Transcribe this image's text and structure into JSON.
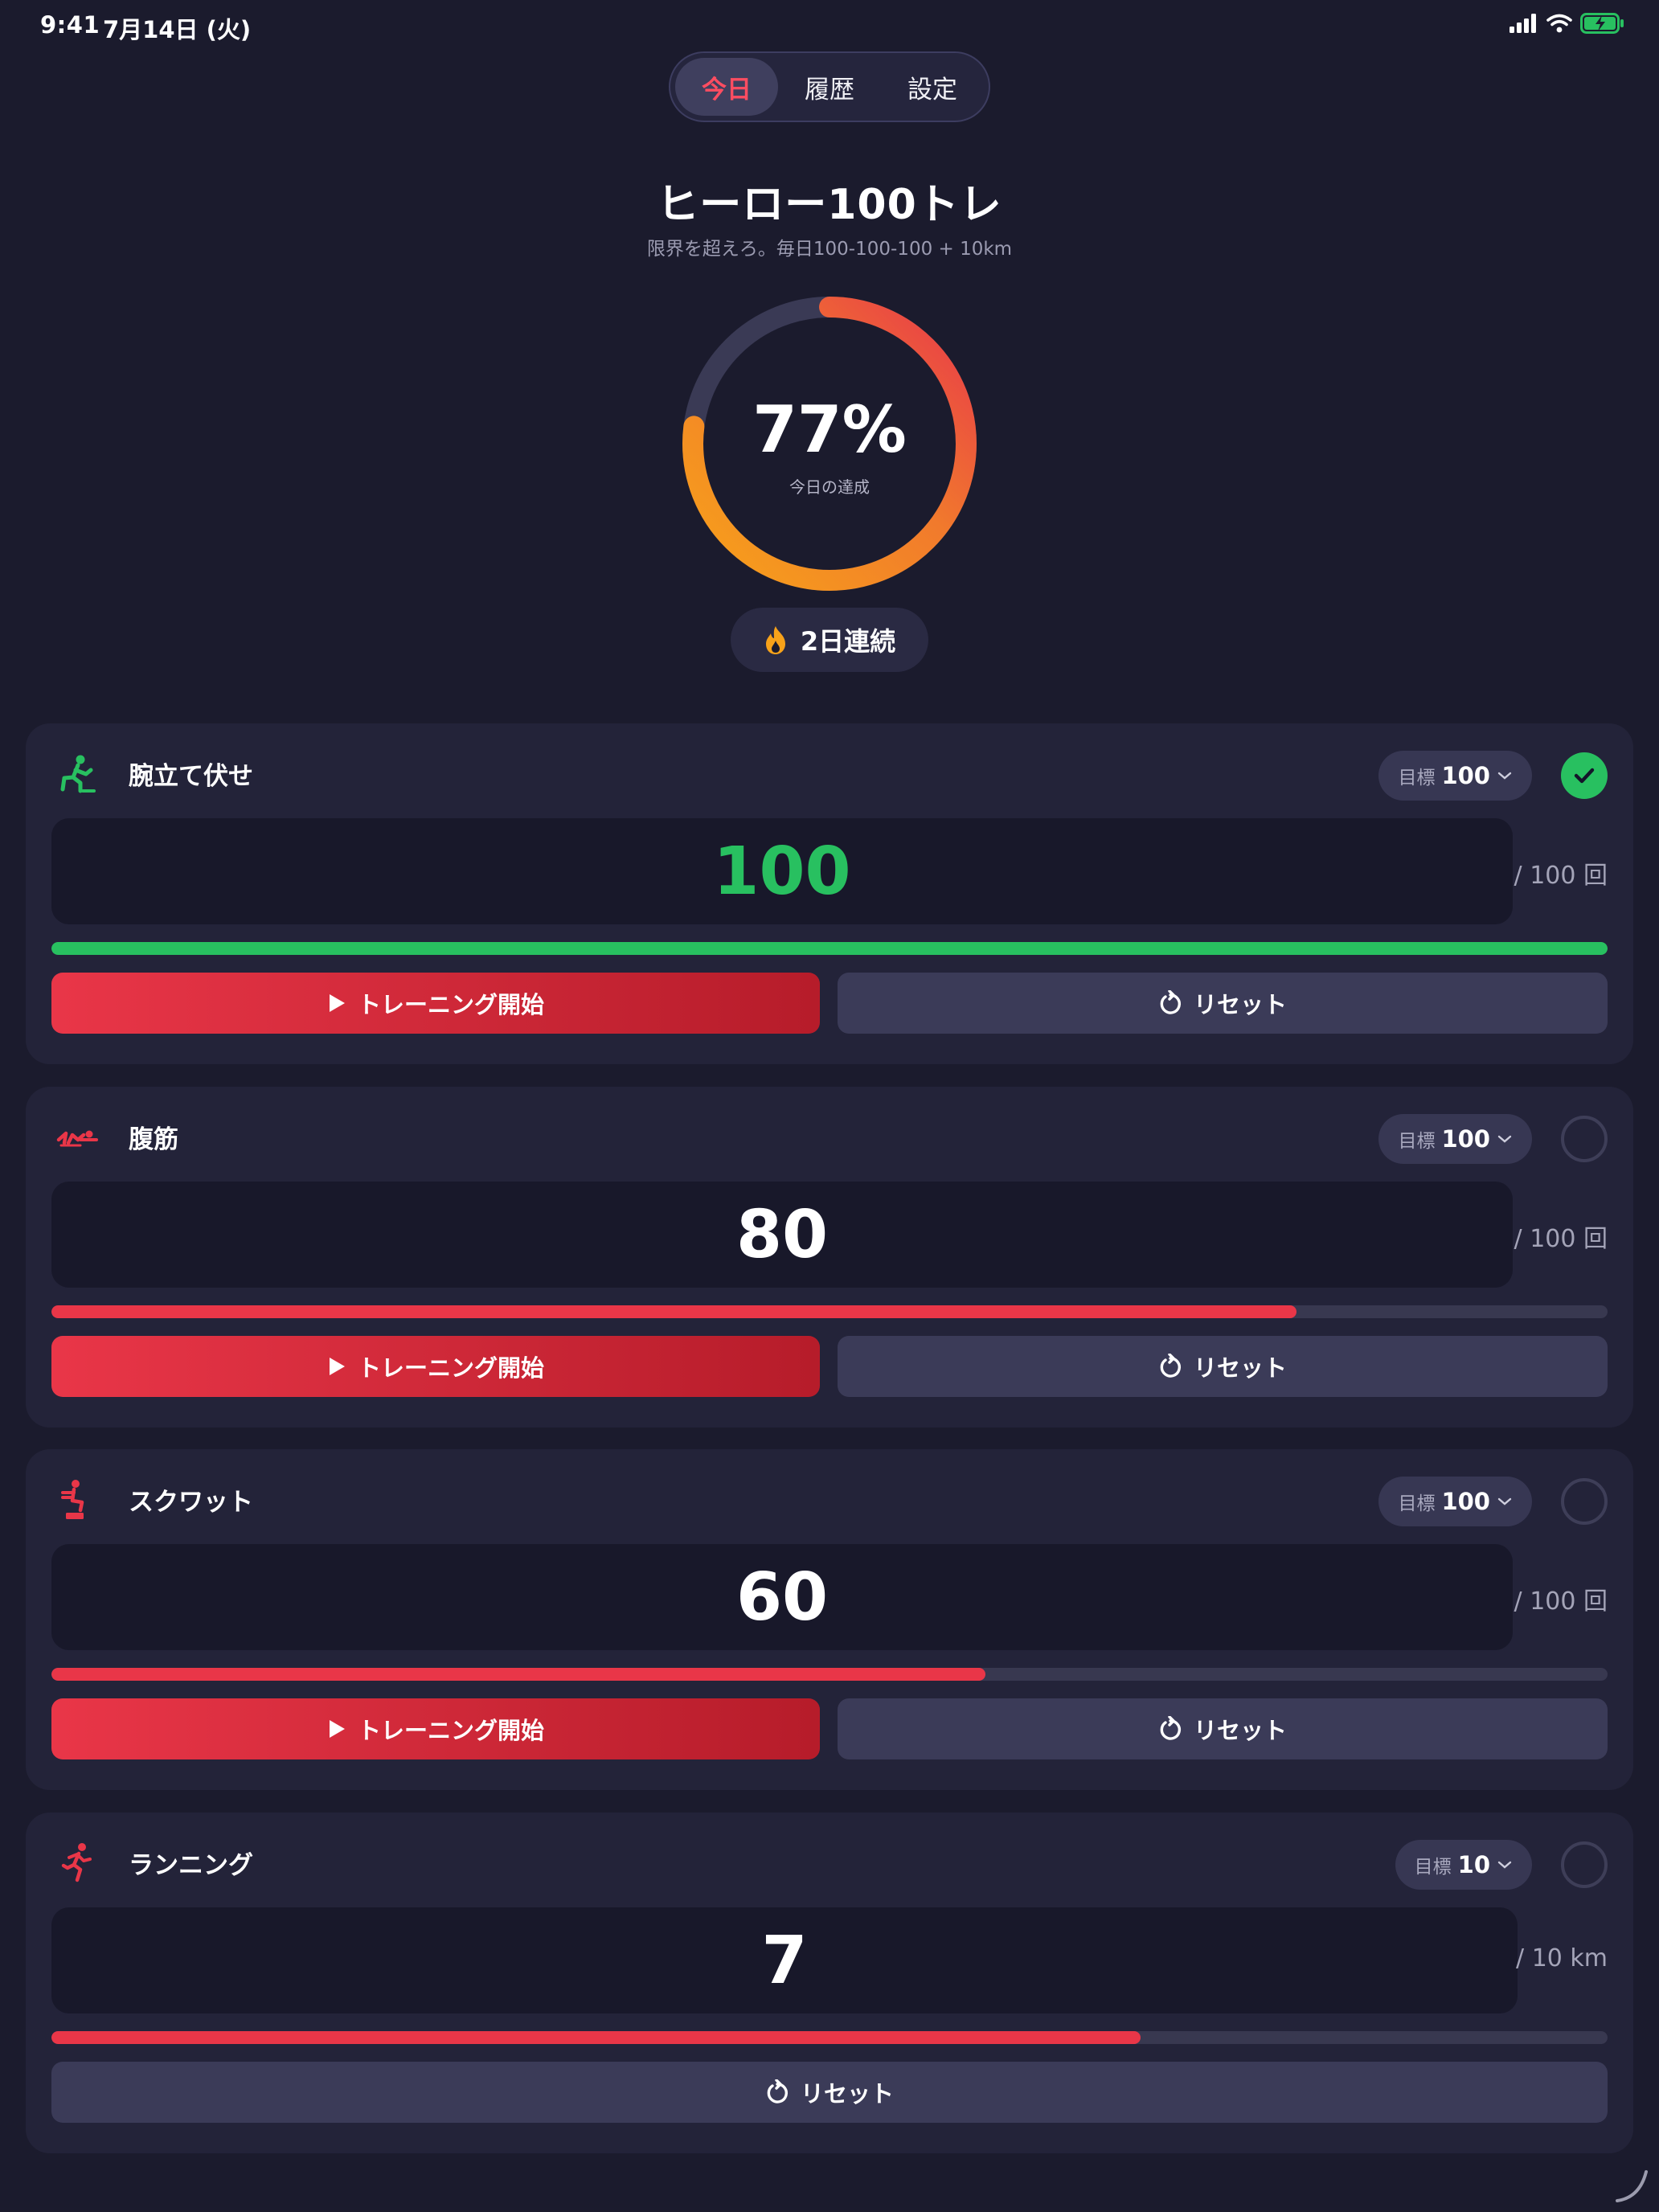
{
  "status_bar": {
    "time": "9:41",
    "date": "7月14日 (火)"
  },
  "tabs": [
    {
      "label": "今日",
      "active": true
    },
    {
      "label": "履歴",
      "active": false
    },
    {
      "label": "設定",
      "active": false
    }
  ],
  "header": {
    "title": "ヒーロー100トレ",
    "subtitle": "限界を超えろ。毎日100-100-100 + 10km"
  },
  "progress": {
    "percent_label": "77%",
    "caption": "今日の達成",
    "value": 0.77
  },
  "streak": {
    "icon": "flame-icon",
    "label": "2日連続"
  },
  "exercises": [
    {
      "title": "腕立て伏せ",
      "icon": "pushup-icon",
      "goal_label": "目標",
      "goal_value": "100",
      "count": "100",
      "unit": "/ 100 回",
      "progress": 1.0,
      "completed": true,
      "start_label": "トレーニング開始",
      "reset_label": "リセット"
    },
    {
      "title": "腹筋",
      "icon": "situp-icon",
      "goal_label": "目標",
      "goal_value": "100",
      "count": "80",
      "unit": "/ 100 回",
      "progress": 0.8,
      "completed": false,
      "start_label": "トレーニング開始",
      "reset_label": "リセット"
    },
    {
      "title": "スクワット",
      "icon": "squat-icon",
      "goal_label": "目標",
      "goal_value": "100",
      "count": "60",
      "unit": "/ 100 回",
      "progress": 0.6,
      "completed": false,
      "start_label": "トレーニング開始",
      "reset_label": "リセット"
    },
    {
      "title": "ランニング",
      "icon": "running-icon",
      "goal_label": "目標",
      "goal_value": "10",
      "count": "7",
      "unit": "/ 10 km",
      "progress": 0.7,
      "completed": false,
      "reset_label": "リセット"
    }
  ],
  "colors": {
    "background": "#1b1b2d",
    "card": "#232339",
    "accent_red": "#e93648",
    "accent_orange": "#f39a1a",
    "done_green": "#28c060"
  }
}
